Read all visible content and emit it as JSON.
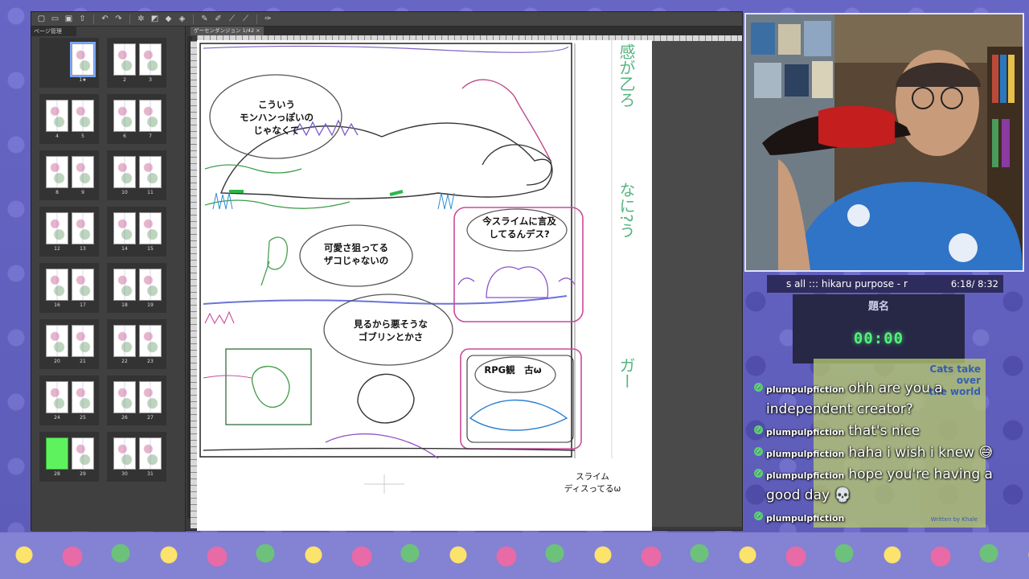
{
  "app": {
    "panel_tab": "ページ管理",
    "doc_tab": "ゲーセンダンジョン 1/42"
  },
  "pages": {
    "spreads": [
      {
        "left": "1",
        "right": null,
        "selected": "1"
      },
      {
        "left": "2",
        "right": "3"
      },
      {
        "left": "4",
        "right": "5"
      },
      {
        "left": "6",
        "right": "7"
      },
      {
        "left": "8",
        "right": "9"
      },
      {
        "left": "10",
        "right": "11"
      },
      {
        "left": "12",
        "right": "13"
      },
      {
        "left": "14",
        "right": "15"
      },
      {
        "left": "16",
        "right": "17"
      },
      {
        "left": "18",
        "right": "19"
      },
      {
        "left": "20",
        "right": "21"
      },
      {
        "left": "22",
        "right": "23"
      },
      {
        "left": "24",
        "right": "25"
      },
      {
        "left": "26",
        "right": "27"
      },
      {
        "left": "28",
        "right": "29"
      },
      {
        "left": "30",
        "right": "31"
      }
    ]
  },
  "canvas": {
    "bubble1": "こういう\nモンハンっぽいの\nじゃなくて",
    "bubble2": "可愛さ狙ってる\nザコじゃないの",
    "bubble3": "今スライムに言及\nしてるんデス?",
    "bubble4": "見るから悪そうな\nゴブリンとかさ",
    "bubble5": "RPG観　古ω",
    "margin_note": "スライム\nディスってるω",
    "pencil_top": "感が乙ろ",
    "pencil_mid": "なに?う",
    "pencil_low": "ガー"
  },
  "overlay": {
    "now_playing": {
      "track": "s all  :::  hikaru purpose - r",
      "time": "6:18/ 8:32"
    },
    "timer": {
      "title": "題名",
      "value": "00:00"
    },
    "chat_art": {
      "title": "Cats take\nover\nthe world",
      "credit": "Written by Khale"
    },
    "chat": [
      {
        "user": "plumpulpfiction",
        "text": "ohh are you a independent creator?"
      },
      {
        "user": "plumpulpfiction",
        "text": "that's nice"
      },
      {
        "user": "plumpulpfiction",
        "text": "haha i wish i knew 😅"
      },
      {
        "user": "plumpulpfiction",
        "text": "hope you're having a good day 💀"
      },
      {
        "user": "plumpulpfiction",
        "text": ""
      }
    ]
  }
}
